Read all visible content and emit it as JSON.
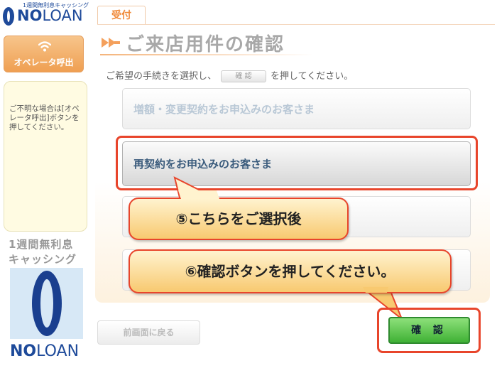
{
  "sidebar": {
    "logo_tagline": "1週間無利息キャッシング",
    "logo_brand_no": "NO",
    "logo_brand_loan": "LOAN",
    "operator_button": "オペレータ呼出",
    "help_text": "ご不明な場合は[オペレータ呼出]ボタンを押してください。",
    "promo_line1": "1週間無利息",
    "promo_line2": "キャッシング",
    "brand_no": "NO",
    "brand_loan": "LOAN"
  },
  "tab": {
    "label": "受付"
  },
  "header": {
    "title": "ご来店用件の確認",
    "instruction_before": "ご希望の手続きを選択し、",
    "instruction_button": "確 認",
    "instruction_after": "を押してください。"
  },
  "options": [
    {
      "label": "増額・変更契約をお申込みのお客さま"
    },
    {
      "label": "再契約をお申込みのお客さま"
    },
    {
      "label": ""
    },
    {
      "label": ""
    }
  ],
  "callouts": {
    "step5": "⑤こちらをご選択後",
    "step6": "⑥確認ボタンを押してください。"
  },
  "footer": {
    "back_button": "前画面に戻る",
    "confirm_button": "確 認"
  },
  "colors": {
    "highlight": "#e8452b",
    "brand_blue": "#1e4a9a",
    "accent_orange": "#f08a3a",
    "confirm_green": "#3fb135"
  }
}
